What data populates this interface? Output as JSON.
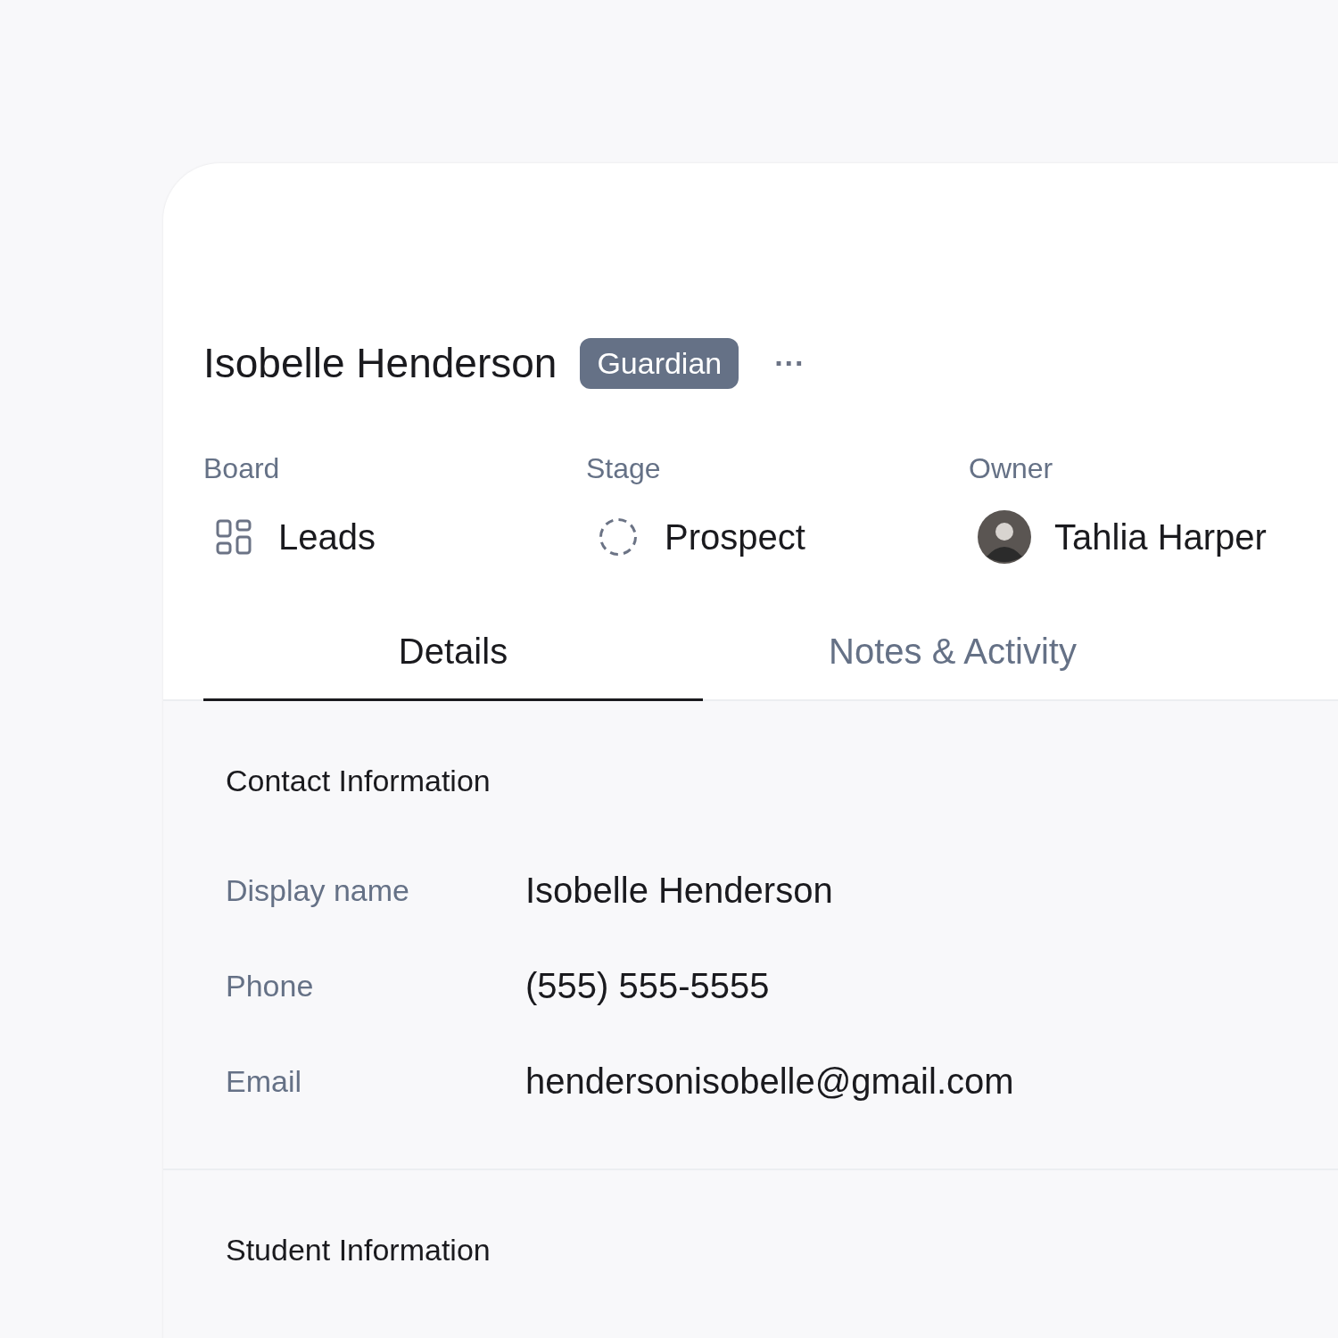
{
  "contact": {
    "name": "Isobelle Henderson",
    "badge": "Guardian",
    "more": "···"
  },
  "fields": [
    {
      "kind": "board",
      "label": "Board",
      "value": "Leads"
    },
    {
      "kind": "stage",
      "label": "Stage",
      "value": "Prospect"
    },
    {
      "kind": "owner",
      "label": "Owner",
      "value": "Tahlia Harper"
    }
  ],
  "tabs": [
    {
      "label": "Details",
      "selected": true
    },
    {
      "label": "Notes & Activity",
      "selected": false
    }
  ],
  "sections": [
    {
      "title": "Contact Information",
      "rows": [
        {
          "label": "Display name",
          "value": "Isobelle Henderson"
        },
        {
          "label": "Phone",
          "value": "(555) 555-5555"
        },
        {
          "label": "Email",
          "value": "hendersonisobelle@gmail.com"
        }
      ]
    },
    {
      "title": "Student Information"
    }
  ]
}
